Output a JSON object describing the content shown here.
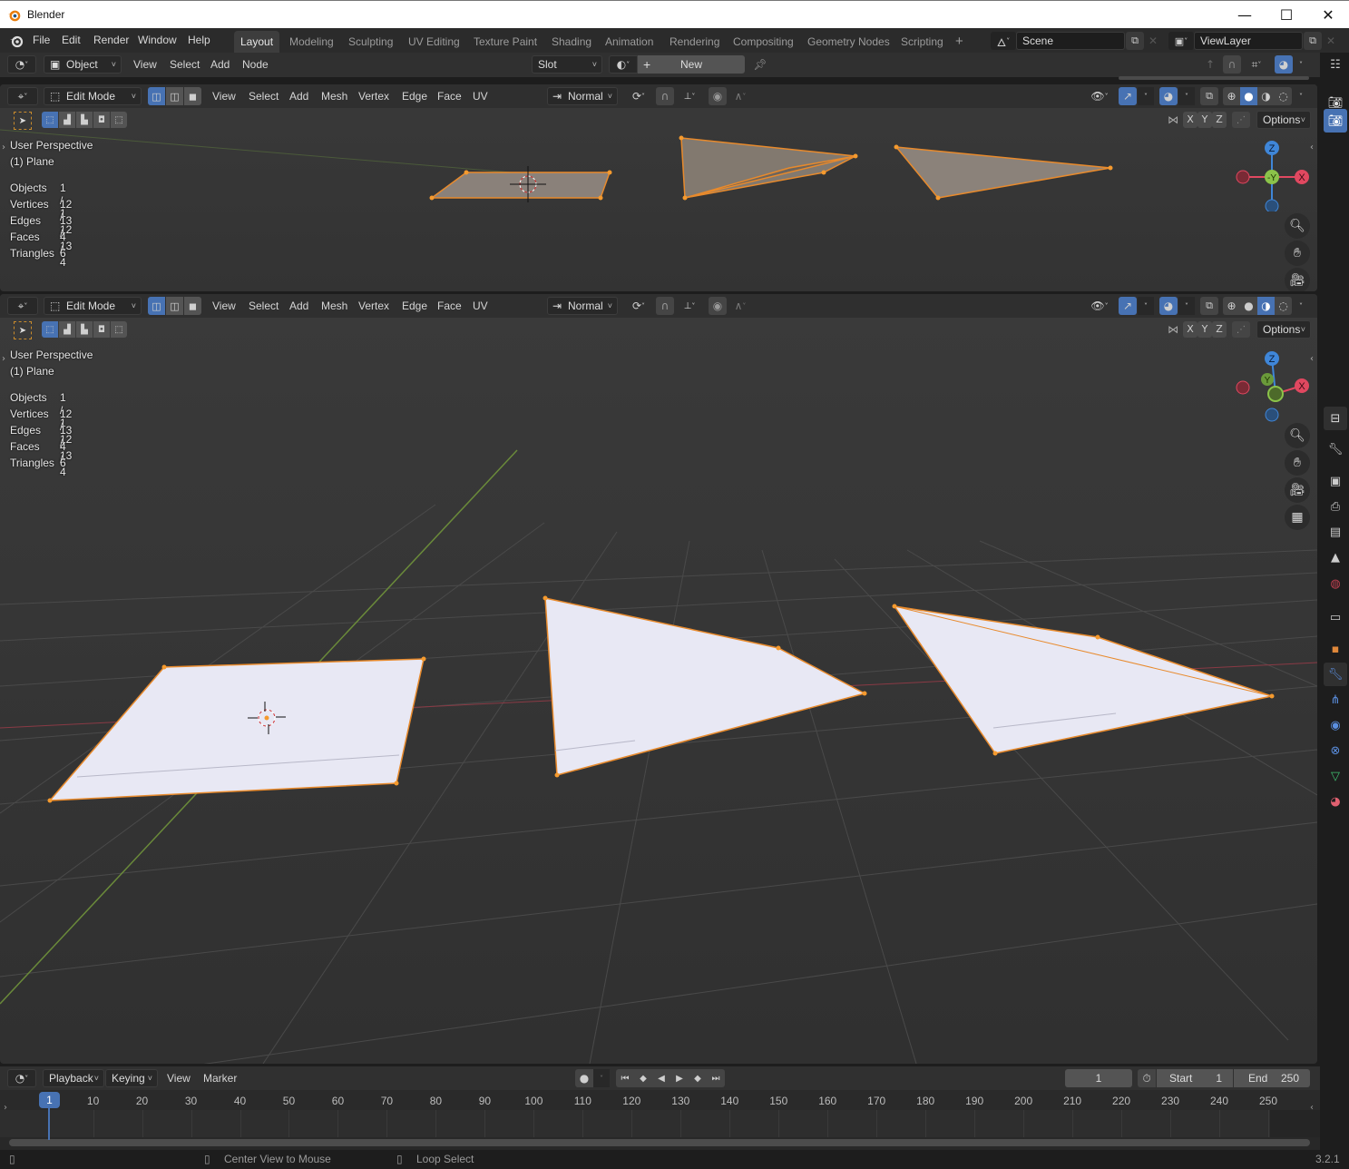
{
  "window": {
    "title": "Blender",
    "minimize": "—",
    "maximize": "☐",
    "close": "✕"
  },
  "topbar": {
    "menus": [
      "File",
      "Edit",
      "Render",
      "Window",
      "Help"
    ],
    "workspaces": [
      "Layout",
      "Modeling",
      "Sculpting",
      "UV Editing",
      "Texture Paint",
      "Shading",
      "Animation",
      "Rendering",
      "Compositing",
      "Geometry Nodes",
      "Scripting"
    ],
    "active_workspace": "Layout",
    "add_workspace": "+",
    "scene": "Scene",
    "view_layer": "ViewLayer"
  },
  "header2": {
    "mode": "Object",
    "menus": [
      "View",
      "Select",
      "Add",
      "Node"
    ],
    "slot": "Slot",
    "new_label": "New",
    "plus": "+"
  },
  "viewports": [
    {
      "mode": "Edit Mode",
      "menus": [
        "View",
        "Select",
        "Add",
        "Mesh",
        "Vertex",
        "Edge",
        "Face",
        "UV"
      ],
      "orientation": "Normal",
      "axes": [
        "X",
        "Y",
        "Z"
      ],
      "options": "Options",
      "perspective": "User Perspective",
      "object": "(1) Plane",
      "stats": [
        {
          "label": "Objects",
          "value": "1 / 1"
        },
        {
          "label": "Vertices",
          "value": "12 / 12"
        },
        {
          "label": "Edges",
          "value": "13 / 13"
        },
        {
          "label": "Faces",
          "value": "4 / 4"
        },
        {
          "label": "Triangles",
          "value": "6"
        }
      ],
      "gizmo": {
        "z": "Z",
        "y": "-Y",
        "x": "X"
      },
      "shading": "solid"
    },
    {
      "mode": "Edit Mode",
      "menus": [
        "View",
        "Select",
        "Add",
        "Mesh",
        "Vertex",
        "Edge",
        "Face",
        "UV"
      ],
      "orientation": "Normal",
      "axes": [
        "X",
        "Y",
        "Z"
      ],
      "options": "Options",
      "perspective": "User Perspective",
      "object": "(1) Plane",
      "stats": [
        {
          "label": "Objects",
          "value": "1 / 1"
        },
        {
          "label": "Vertices",
          "value": "12 / 12"
        },
        {
          "label": "Edges",
          "value": "13 / 13"
        },
        {
          "label": "Faces",
          "value": "4 / 4"
        },
        {
          "label": "Triangles",
          "value": "6"
        }
      ],
      "gizmo": {
        "z": "Z",
        "y": "Y",
        "x": "X"
      },
      "shading": "material-preview"
    }
  ],
  "timeline": {
    "menus": [
      "Playback",
      "Keying",
      "View",
      "Marker"
    ],
    "current_frame": "1",
    "start_label": "Start",
    "start": "1",
    "end_label": "End",
    "end": "250",
    "ticks": [
      "10",
      "20",
      "30",
      "40",
      "50",
      "60",
      "70",
      "80",
      "90",
      "100",
      "110",
      "120",
      "130",
      "140",
      "150",
      "160",
      "170",
      "180",
      "190",
      "200",
      "210",
      "220",
      "230",
      "240",
      "250"
    ],
    "playhead": "1"
  },
  "statusbar": {
    "middle_hint": "Center View to Mouse",
    "right_hint": "Loop Select",
    "version": "3.2.1"
  },
  "colors": {
    "accent": "#4772b3",
    "selection": "#f59a2e",
    "axis_x": "#e04860",
    "axis_y": "#8bc34a",
    "axis_z": "#3f86d8"
  }
}
